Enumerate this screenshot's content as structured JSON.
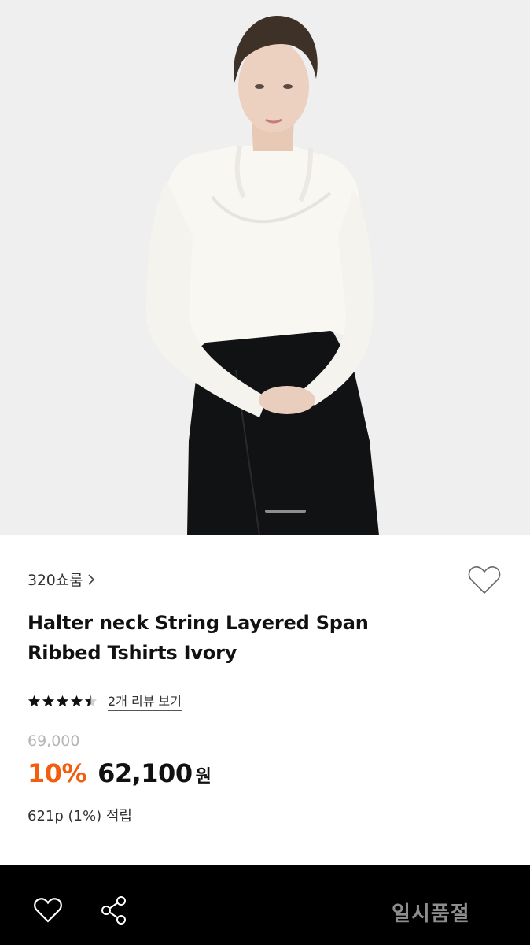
{
  "hero": {
    "image_alt": "Model wearing ivory halter neck layered ribbed t-shirt with black skirt"
  },
  "product": {
    "brand": "320쇼룸",
    "title_line1": "Halter neck String Layered Span",
    "title_line2": "Ribbed Tshirts Ivory",
    "rating": 4.5,
    "review_link": "2개 리뷰 보기",
    "original_price": "69,000",
    "discount": "10%",
    "price": "62,100",
    "currency": "원",
    "points": "621p (1%) 적립"
  },
  "bottom_bar": {
    "status_label": "일시품절"
  },
  "colors": {
    "accent": "#f25d0f",
    "bottom_bar_bg": "#000000",
    "muted": "#b5b5b5"
  },
  "icons": {
    "brand_chevron": "chevron-right-icon",
    "wish": "heart-outline-icon",
    "share": "share-icon",
    "star": "star-icon"
  }
}
